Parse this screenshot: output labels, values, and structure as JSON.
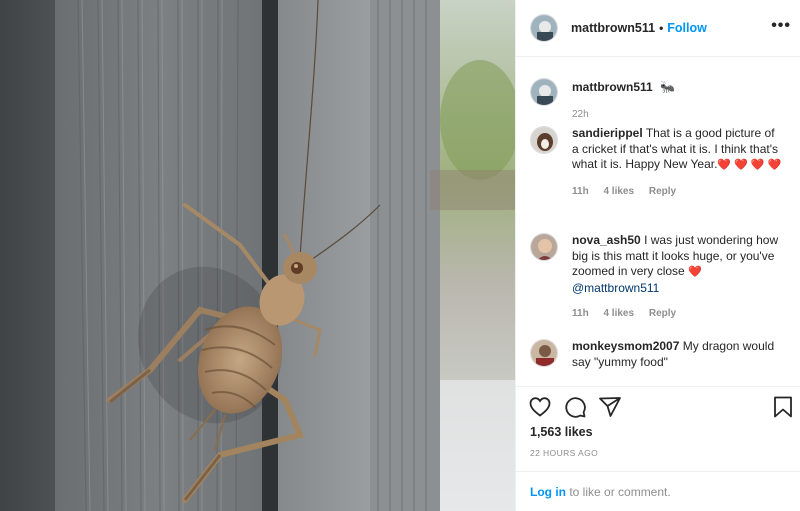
{
  "post": {
    "username": "mattbrown511",
    "follow_label": "Follow",
    "dot": "•",
    "more_label": "•••"
  },
  "caption": {
    "username": "mattbrown511",
    "text": "🐜",
    "time": "22h"
  },
  "comments": [
    {
      "username": "sandierippel",
      "text": "That is a good picture of a cricket if that's what it is. I think that's what it is. Happy New Year.",
      "hearts": "❤️ ❤️ ❤️ ❤️",
      "time": "11h",
      "likes": "4 likes",
      "reply": "Reply"
    },
    {
      "username": "nova_ash50",
      "text": "I was just wondering how big is this matt it looks huge, or you've zoomed in very close",
      "heart": "❤️",
      "mention": "@mattbrown511",
      "time": "11h",
      "likes": "4 likes",
      "reply": "Reply"
    },
    {
      "username": "monkeysmom2007",
      "text": "My dragon would say \"yummy food\""
    }
  ],
  "actions": {
    "likes": "1,563 likes",
    "ago": "22 HOURS AGO",
    "login_link": "Log in",
    "login_suffix": " to like or comment."
  },
  "colors": {
    "accent": "#0095f6",
    "text": "#262626",
    "muted": "#8e8e8e",
    "heart": "#e0245e",
    "border": "#efefef"
  }
}
